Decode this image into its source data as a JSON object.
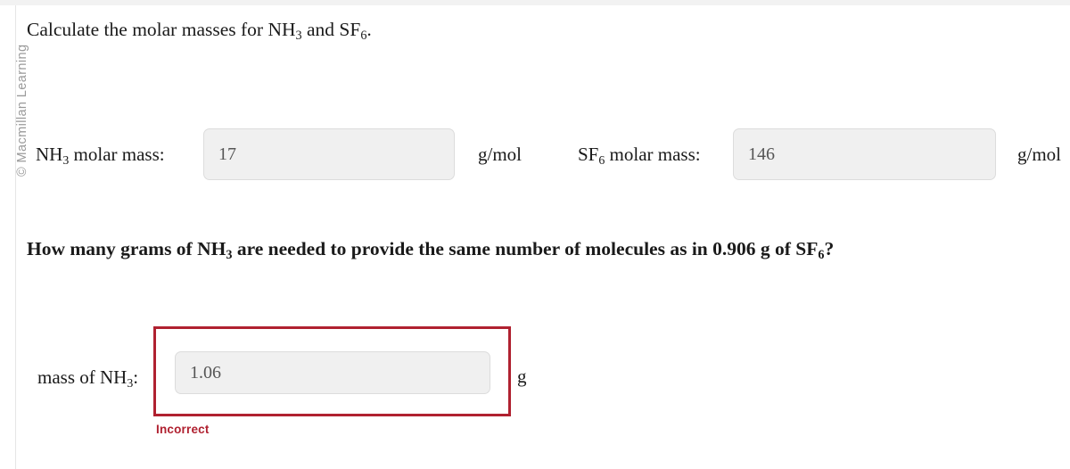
{
  "watermark": {
    "text": "© Macmillan Learning"
  },
  "prompt": {
    "title_pre": "Calculate the molar masses for ",
    "title_species_1_base": "NH",
    "title_species_1_sub": "3",
    "title_mid": " and ",
    "title_species_2_base": "SF",
    "title_species_2_sub": "6",
    "title_post": "."
  },
  "molar_mass_row": {
    "nh3": {
      "label_base": "NH",
      "label_sub": "3",
      "label_text": " molar mass:",
      "value": "17",
      "placeholder": "",
      "unit": "g/mol"
    },
    "sf6": {
      "label_base": "SF",
      "label_sub": "6",
      "label_text": " molar mass:",
      "value": "146",
      "placeholder": "",
      "unit": "g/mol"
    }
  },
  "question": {
    "part_1": "How many grams of ",
    "species_1_base": "NH",
    "species_1_sub": "3",
    "part_2": " are needed to provide the same number of molecules as in 0.906 g of ",
    "species_2_base": "SF",
    "species_2_sub": "6",
    "part_3": "?"
  },
  "answer": {
    "label_pre": "mass of ",
    "label_base": "NH",
    "label_sub": "3",
    "label_post": ":",
    "value": "1.06",
    "placeholder": "",
    "unit": "g",
    "feedback": "Incorrect",
    "feedback_color": "#b02130",
    "state": "incorrect"
  },
  "colors": {
    "page_background": "#ffffff",
    "input_background": "#f0f0f0",
    "input_border": "#dcdcdc",
    "input_text": "#555555",
    "error_red": "#b02130",
    "watermark_gray": "#9a9a9a",
    "body_text": "#1a1a1a"
  }
}
